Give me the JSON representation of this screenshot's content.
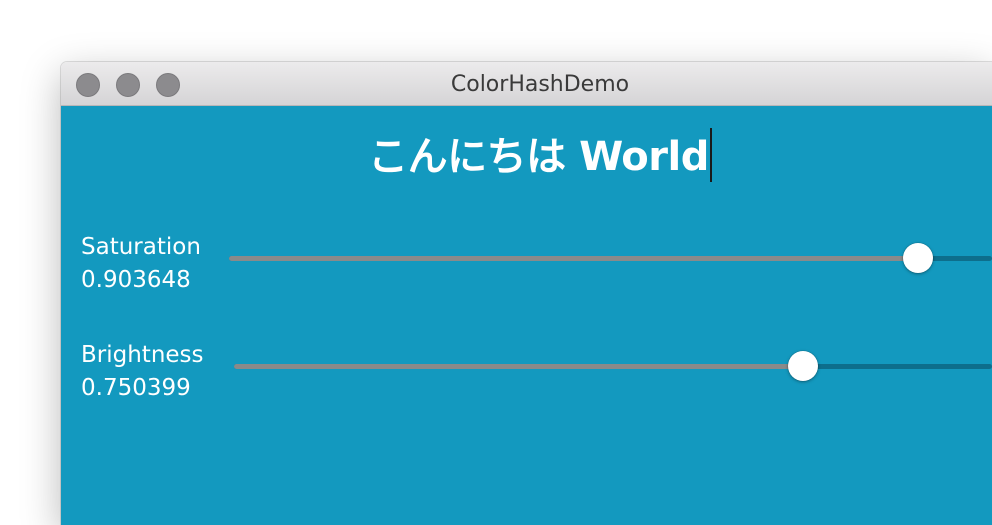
{
  "window": {
    "title": "ColorHashDemo"
  },
  "headline": {
    "text": "こんにちは World"
  },
  "saturation": {
    "label": "Saturation",
    "value": "0.903648",
    "fraction": 0.903648
  },
  "brightness": {
    "label": "Brightness",
    "value": "0.750399",
    "fraction": 0.750399
  },
  "colors": {
    "background": "#1399bf",
    "track_remaining": "#0d6e8c",
    "track_filled": "#8a8a8a",
    "text": "#ffffff"
  }
}
